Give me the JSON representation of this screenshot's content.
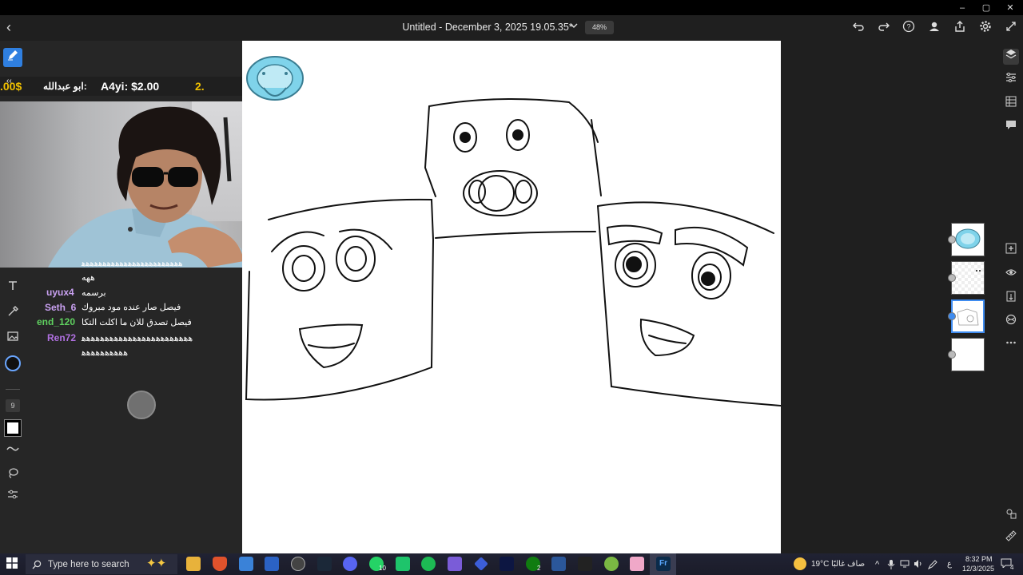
{
  "window": {
    "back_glyph": "‹",
    "title": "Untitled - December 3, 2025 19.05.35*",
    "zoom": "48%",
    "controls": [
      "–",
      "▢",
      "✕"
    ]
  },
  "header_icons": [
    "undo-icon",
    "redo-icon",
    "help-icon",
    "account-icon",
    "share-icon",
    "settings-icon",
    "fullscreen-icon"
  ],
  "left_tools": {
    "size_value": "9"
  },
  "overlay": {
    "donations": [
      {
        "text": ".00$",
        "color": "#f0c000"
      },
      {
        "text": "ابو عبدالله:",
        "color": "#ffffff"
      },
      {
        "text": "A4yi: $2.00",
        "color": "#ffffff"
      },
      {
        "text": "2.",
        "color": "#f0c000"
      }
    ],
    "chat_top_line": "ﻫﻫﻫﻫﻫﻫﻫﻫﻫﻫﻫﻫﻫﻫﻫﻫﻫﻫﻫﻫﻫﻫﻫﻫ",
    "chat": [
      {
        "user": "",
        "user_color": "#ffffff",
        "message": "ههه"
      },
      {
        "user": "uyux4",
        "user_color": "#c8a0f0",
        "message": "برسمه"
      },
      {
        "user": "Seth_6",
        "user_color": "#c8a0f0",
        "message": "فيصل صار عنده مود مبروك"
      },
      {
        "user": "end_120",
        "user_color": "#5fd05f",
        "message": "فيصل تصدق للان ما اكلت التكا"
      },
      {
        "user": "Ren72",
        "user_color": "#b070e0",
        "message": "ﻫﻫﻫﻫﻫﻫﻫﻫﻫﻫﻫﻫﻫﻫﻫﻫﻫﻫﻫﻫﻫﻫﻫﻫ"
      },
      {
        "user": "",
        "user_color": "#ffffff",
        "message": "ﻫﻫﻫﻫﻫﻫﻫﻫﻫﻫ"
      }
    ]
  },
  "taskbar": {
    "search_placeholder": "Type here to search",
    "weather_temp": "19°C",
    "weather_text": "صاف غالبًا",
    "lang": "ع",
    "time": "8:32 PM",
    "date": "12/3/2025",
    "notif_count": "4",
    "badge_whatsapp": "10",
    "badge_xbox": "2"
  },
  "colors": {
    "accent": "#2f7fe0",
    "canvas": "#ffffff",
    "app_bg": "#1f1f1f",
    "panel": "#262626"
  }
}
